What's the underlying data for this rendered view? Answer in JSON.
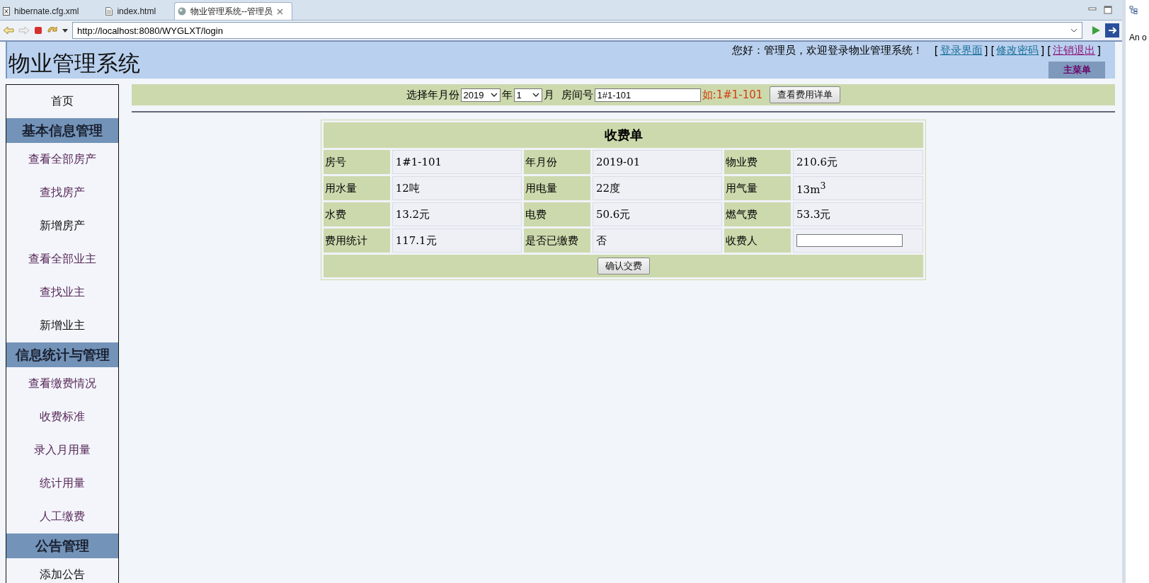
{
  "browser": {
    "tabs": [
      {
        "label": "hibernate.cfg.xml",
        "kind": "xml",
        "selected": false
      },
      {
        "label": "index.html",
        "kind": "doc",
        "selected": false
      },
      {
        "label": "物业管理系统--管理员",
        "kind": "web",
        "selected": true
      }
    ],
    "url": "http://localhost:8080/WYGLXT/login",
    "side_text": "An o"
  },
  "header": {
    "title": "物业管理系统",
    "greeting": "您好：管理员，欢迎登录物业管理系统！",
    "links": [
      {
        "open": "[",
        "label": "登录界面",
        "close": "]",
        "visited": false
      },
      {
        "open": "[",
        "label": "修改密码",
        "close": "]",
        "visited": false
      },
      {
        "open": "[",
        "label": "注销退出",
        "close": "]",
        "visited": true
      }
    ],
    "menu_button": "主菜单"
  },
  "sidebar": {
    "items": [
      {
        "kind": "link",
        "label": "首页",
        "visited": false
      },
      {
        "kind": "heading",
        "label": "基本信息管理"
      },
      {
        "kind": "link",
        "label": "查看全部房产",
        "visited": true
      },
      {
        "kind": "link",
        "label": "查找房产",
        "visited": true
      },
      {
        "kind": "link",
        "label": "新增房产",
        "visited": false
      },
      {
        "kind": "link",
        "label": "查看全部业主",
        "visited": true
      },
      {
        "kind": "link",
        "label": "查找业主",
        "visited": true
      },
      {
        "kind": "link",
        "label": "新增业主",
        "visited": false
      },
      {
        "kind": "heading",
        "label": "信息统计与管理"
      },
      {
        "kind": "link",
        "label": "查看缴费情况",
        "visited": true
      },
      {
        "kind": "link",
        "label": "收费标准",
        "visited": true
      },
      {
        "kind": "link",
        "label": "录入月用量",
        "visited": true
      },
      {
        "kind": "link",
        "label": "统计用量",
        "visited": true
      },
      {
        "kind": "link",
        "label": "人工缴费",
        "visited": true
      },
      {
        "kind": "heading",
        "label": "公告管理"
      },
      {
        "kind": "link",
        "label": "添加公告",
        "visited": false
      }
    ]
  },
  "filter": {
    "month_label": "选择年月份",
    "year": "2019",
    "year_unit": "年",
    "month": "1",
    "month_unit": "月",
    "room_label": "房间号",
    "room": "1#1-101",
    "hint": "如:1#1-101",
    "button": "查看费用详单"
  },
  "bill": {
    "title": "收费单",
    "rows": [
      [
        {
          "label": "房号",
          "value": "1#1-101"
        },
        {
          "label": "年月份",
          "value": "2019-01"
        },
        {
          "label": "物业费",
          "value": "210.6元"
        }
      ],
      [
        {
          "label": "用水量",
          "value": "12吨"
        },
        {
          "label": "用电量",
          "value": "22度"
        },
        {
          "label": "用气量",
          "value": "13m$^{3}$"
        }
      ],
      [
        {
          "label": "水费",
          "value": "13.2元"
        },
        {
          "label": "电费",
          "value": "50.6元"
        },
        {
          "label": "燃气费",
          "value": "53.3元"
        }
      ],
      [
        {
          "label": "费用统计",
          "value": "117.1元"
        },
        {
          "label": "是否已缴费",
          "value": "否"
        },
        {
          "label": "收费人",
          "kind": "input"
        }
      ]
    ],
    "button": "确认交费"
  }
}
